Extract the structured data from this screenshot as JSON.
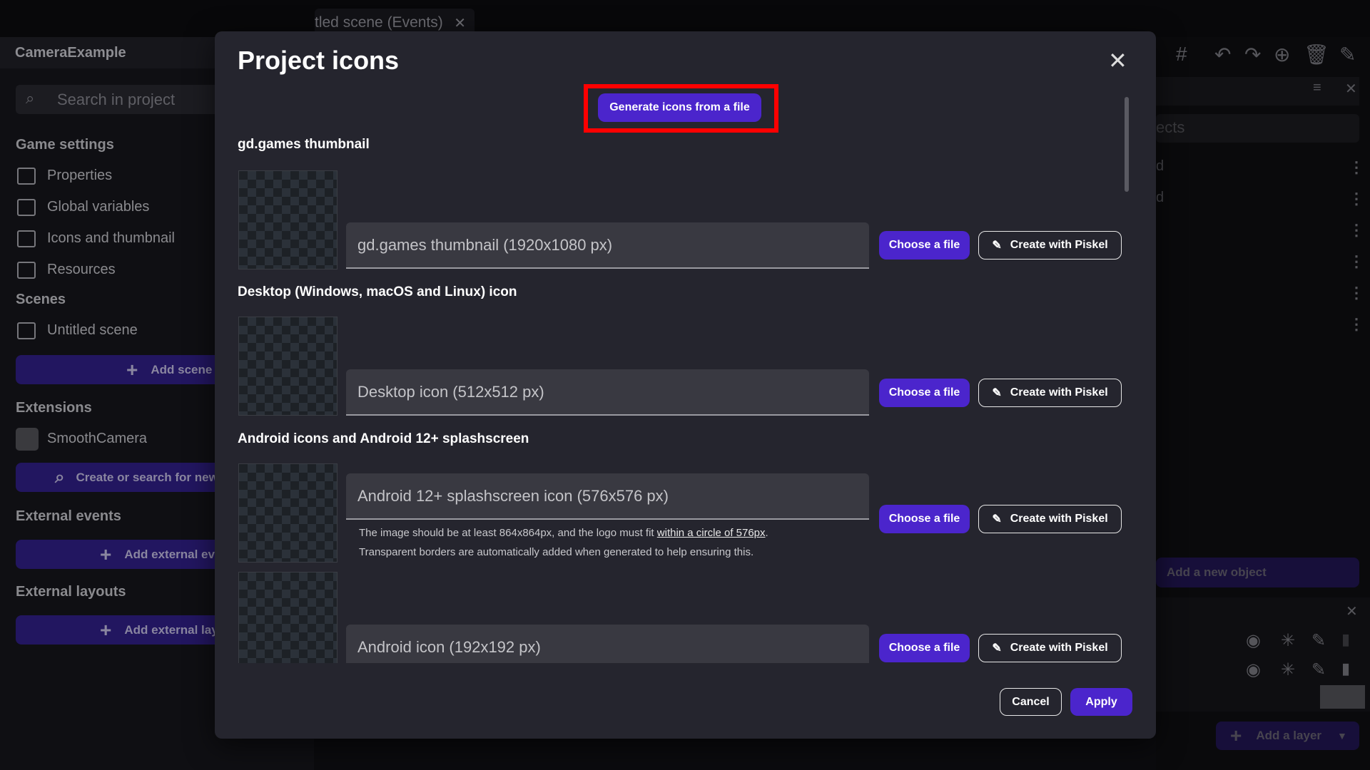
{
  "background": {
    "tab_label": "tled scene (Events)",
    "project_name": "CameraExample",
    "search_placeholder": "Search in project",
    "sections": {
      "game_settings": "Game settings",
      "scenes": "Scenes",
      "extensions": "Extensions",
      "external_events": "External events",
      "external_layouts": "External layouts"
    },
    "game_settings_items": [
      "Properties",
      "Global variables",
      "Icons and thumbnail",
      "Resources"
    ],
    "scene_item": "Untitled scene",
    "add_scene": "Add scene",
    "extension_item": "SmoothCamera",
    "search_extension": "Create or search for new e",
    "add_external_events": "Add external even",
    "add_external_layout": "Add external layo",
    "objects_search_placeholder": "ects",
    "object_items": [
      "d",
      "d"
    ],
    "add_new_object": "Add a new object",
    "add_layer": "Add a layer"
  },
  "dialog": {
    "title": "Project icons",
    "generate_button": "Generate icons from a file",
    "highlight_color": "#ff0000",
    "accent_color": "#4b25cc",
    "sections": [
      {
        "heading": "gd.games thumbnail",
        "fields": [
          {
            "label": "gd.games thumbnail (1920x1080 px)"
          }
        ]
      },
      {
        "heading": "Desktop (Windows, macOS and Linux) icon",
        "fields": [
          {
            "label": "Desktop icon (512x512 px)"
          }
        ]
      },
      {
        "heading": "Android icons and Android 12+ splashscreen",
        "fields": [
          {
            "label": "Android 12+ splashscreen icon (576x576 px)",
            "helper_before": "The image should be at least 864x864px, and the logo must fit ",
            "helper_link": "within a circle of 576px",
            "helper_after": ".",
            "helper_line2": "Transparent borders are automatically added when generated to help ensuring this."
          },
          {
            "label": "Android icon (192x192 px)"
          }
        ]
      }
    ],
    "choose_file": "Choose a file",
    "create_piskel": "Create with Piskel",
    "cancel": "Cancel",
    "apply": "Apply"
  }
}
